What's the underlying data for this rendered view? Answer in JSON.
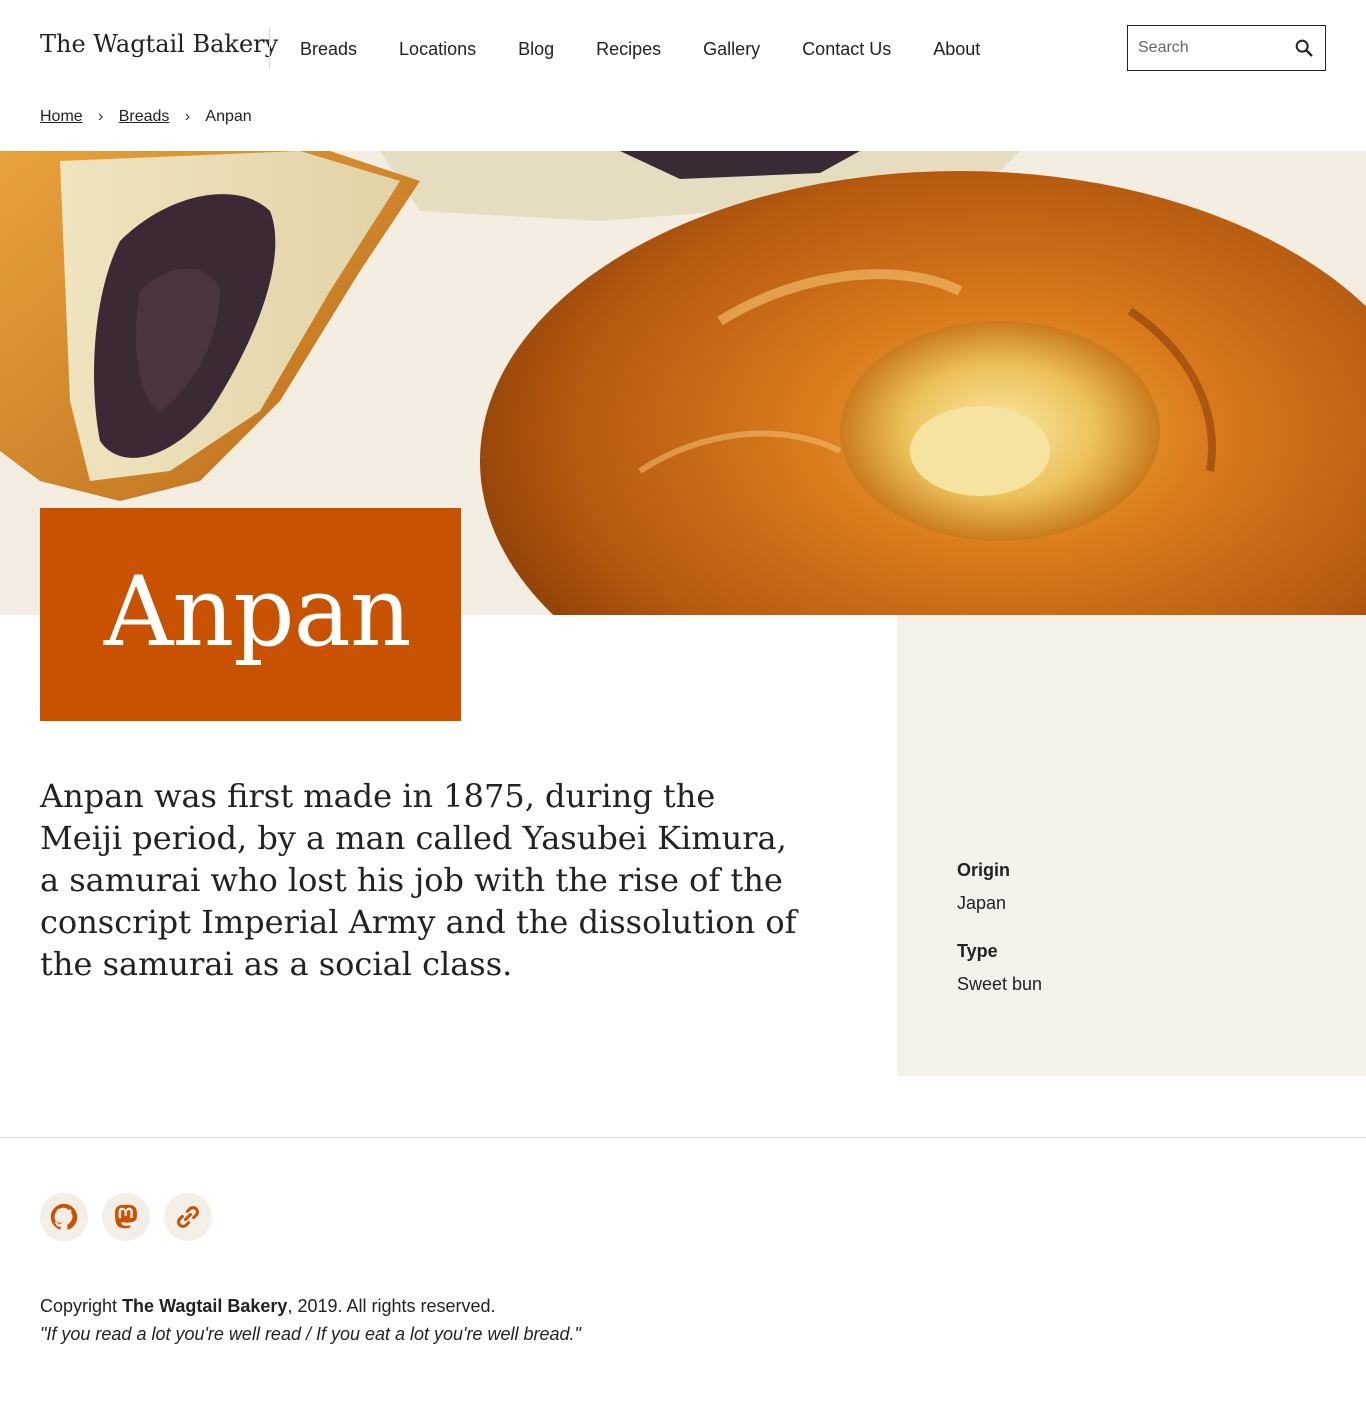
{
  "header": {
    "brand": "The Wagtail Bakery",
    "nav": [
      "Breads",
      "Locations",
      "Blog",
      "Recipes",
      "Gallery",
      "Contact Us",
      "About"
    ],
    "search": {
      "placeholder": "Search",
      "value": "",
      "icon": "search-icon"
    }
  },
  "breadcrumb": {
    "home": "Home",
    "breads": "Breads",
    "current": "Anpan",
    "separator": "›"
  },
  "hero": {
    "image": "anpan-bread-photo"
  },
  "page": {
    "title": "Anpan",
    "intro": "Anpan was first made in 1875, during the Meiji period, by a man called Yasubei Kimura, a samurai who lost his job with the rise of the conscript Imperial Army and the dissolution of the samurai as a social class."
  },
  "details": {
    "origin_label": "Origin",
    "origin_value": "Japan",
    "type_label": "Type",
    "type_value": "Sweet bun"
  },
  "footer": {
    "socials": [
      "github-icon",
      "mastodon-icon",
      "link-icon"
    ],
    "copyright_prefix": "Copyright",
    "copyright_brand": "The Wagtail Bakery",
    "copyright_suffix": ", 2019. All rights reserved.",
    "tagline": "\"If you read a lot you're well read / If you eat a lot you're well bread.\""
  },
  "colors": {
    "accent": "#c85200",
    "sidebar_bg": "#f4f1ea",
    "social_bg": "#f4efe6",
    "text": "#222222"
  }
}
